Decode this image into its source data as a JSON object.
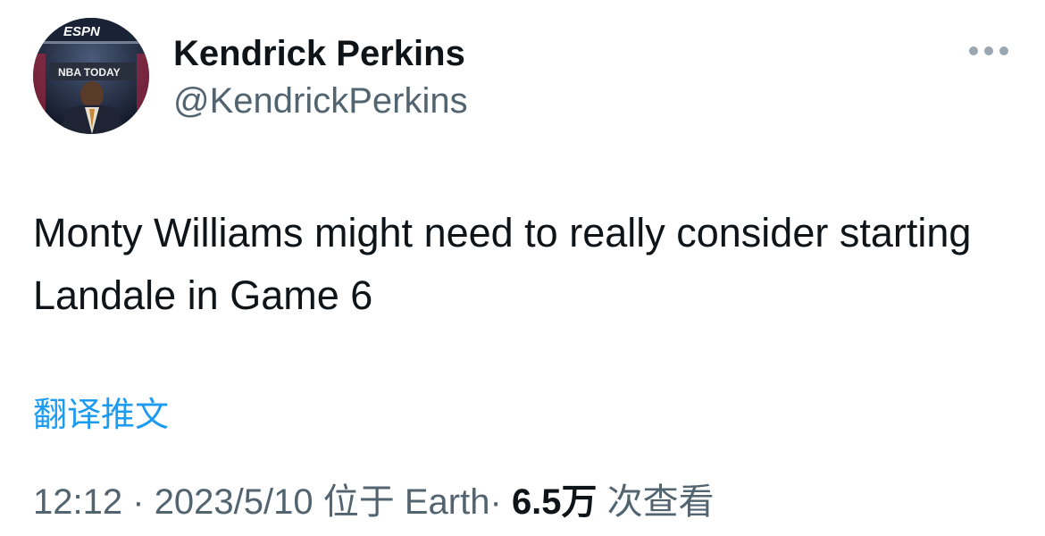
{
  "author": {
    "display_name": "Kendrick Perkins",
    "handle": "@KendrickPerkins",
    "avatar_logo_text": "ESPN",
    "avatar_banner_text": "NBA TODAY"
  },
  "menu": {
    "icon": "more-horizontal-icon"
  },
  "tweet": {
    "text": "Monty Williams might need to really consider starting Landale in Game 6",
    "translate_label": "翻译推文"
  },
  "meta": {
    "time": "12:12",
    "separator": "·",
    "date": "2023/5/10",
    "location": "位于 Earth",
    "views_count": "6.5万",
    "views_label": "次查看"
  },
  "colors": {
    "text_primary": "#0f1419",
    "text_secondary": "#536471",
    "link": "#1d9bf0",
    "icon_gray": "#9aa7b1"
  }
}
